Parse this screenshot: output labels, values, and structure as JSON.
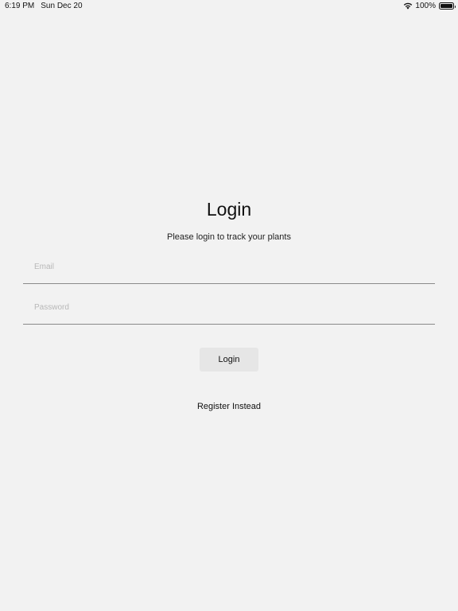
{
  "status_bar": {
    "time": "6:19 PM",
    "date": "Sun Dec 20",
    "battery_percent": "100%",
    "icons": [
      "wifi-icon",
      "battery-icon"
    ]
  },
  "login": {
    "title": "Login",
    "subtitle": "Please login to track your plants",
    "email": {
      "placeholder": "Email",
      "value": ""
    },
    "password": {
      "placeholder": "Password",
      "value": ""
    },
    "login_button_label": "Login",
    "register_label": "Register Instead"
  }
}
